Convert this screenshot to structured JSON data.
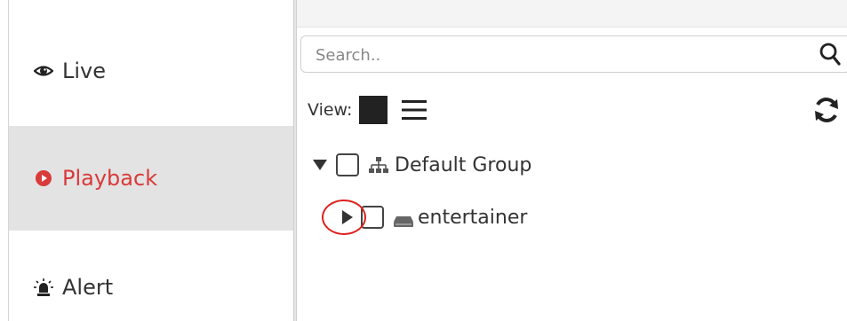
{
  "nav": {
    "live": {
      "label": "Live",
      "icon": "eye-icon"
    },
    "playback": {
      "label": "Playback",
      "icon": "record-icon",
      "active": true
    },
    "alert": {
      "label": "Alert",
      "icon": "alarm-light-icon"
    }
  },
  "search": {
    "placeholder": "Search..",
    "value": ""
  },
  "view": {
    "label": "View:"
  },
  "tree": {
    "group": {
      "label": "Default Group",
      "expanded": true
    },
    "device": {
      "label": "entertainer",
      "expanded": false
    }
  },
  "colors": {
    "active_text": "#d93a3a",
    "active_bg": "#e3e3e3",
    "highlight": "#e01f1f"
  }
}
